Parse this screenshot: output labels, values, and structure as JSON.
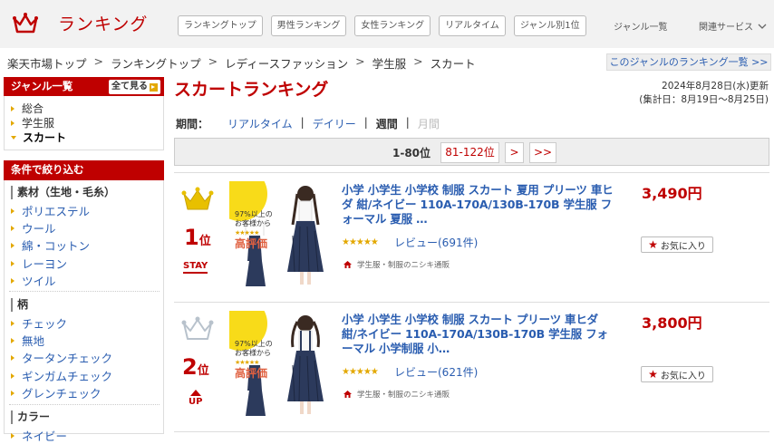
{
  "header": {
    "logo_text": "ランキング",
    "nav": [
      "ランキングトップ",
      "男性ランキング",
      "女性ランキング",
      "リアルタイム",
      "ジャンル別1位"
    ],
    "genre_list": "ジャンル一覧",
    "related": "関連サービス",
    "colors": {
      "brand": "#bf0000",
      "bar": "#f2f2f2"
    }
  },
  "breadcrumb": {
    "items": [
      "楽天市場トップ",
      "ランキングトップ",
      "レディースファッション",
      "学生服",
      "スカート"
    ],
    "separator": ">",
    "right_link": "このジャンルのランキング一覧 >>"
  },
  "sidebar": {
    "genre_title": "ジャンル一覧",
    "see_all": "全て見る",
    "genres": [
      "総合",
      "学生服",
      "スカート"
    ],
    "filter_title": "条件で絞り込む",
    "sections": [
      {
        "title": "素材（生地・毛糸）",
        "items": [
          "ポリエステル",
          "ウール",
          "綿・コットン",
          "レーヨン",
          "ツイル"
        ]
      },
      {
        "title": "柄",
        "items": [
          "チェック",
          "無地",
          "タータンチェック",
          "ギンガムチェック",
          "グレンチェック"
        ]
      },
      {
        "title": "カラー",
        "items": [
          "ネイビー"
        ]
      }
    ]
  },
  "main": {
    "title": "スカートランキング",
    "updated_line1": "2024年8月28日(水)更新",
    "updated_line2": "(集計日：8月19日～8月25日)",
    "period_label": "期間：",
    "periods": [
      "リアルタイム",
      "デイリー",
      "週間",
      "月間"
    ],
    "period_sep": "|",
    "pager": {
      "current": "1-80位",
      "next_range": "81-122位",
      "next": ">",
      "last": ">>"
    }
  },
  "items": [
    {
      "rank": "1",
      "rank_suffix": "位",
      "trend": "STAY",
      "name": "小学 小学生 小学校 制服 スカート 夏用 プリーツ 車ヒダ 紺/ネイビー 110A-170A/130B-170B 学生服 フォーマル 夏服 …",
      "stars": "★★★★★",
      "rating": 4.5,
      "reviews": "レビュー(691件)",
      "shop": "学生服・制服のニシキ通販",
      "price": "3,490円",
      "favorite": "お気に入り",
      "badge_line1": "97%以上の",
      "badge_line2": "お客様から",
      "badge_line3": "高評価",
      "crown_color": "#e8c000"
    },
    {
      "rank": "2",
      "rank_suffix": "位",
      "trend": "UP",
      "name": "小学 小学生 小学校 制服 スカート プリーツ 車ヒダ 紺/ネイビー 110A-170A/130B-170B 学生服 フォーマル 小学制服 小…",
      "stars": "★★★★★",
      "rating": 4.5,
      "reviews": "レビュー(621件)",
      "shop": "学生服・制服のニシキ通販",
      "price": "3,800円",
      "favorite": "お気に入り",
      "badge_line1": "97%以上の",
      "badge_line2": "お客様から",
      "badge_line3": "高評価",
      "crown_color": "#c0c8d0"
    }
  ]
}
